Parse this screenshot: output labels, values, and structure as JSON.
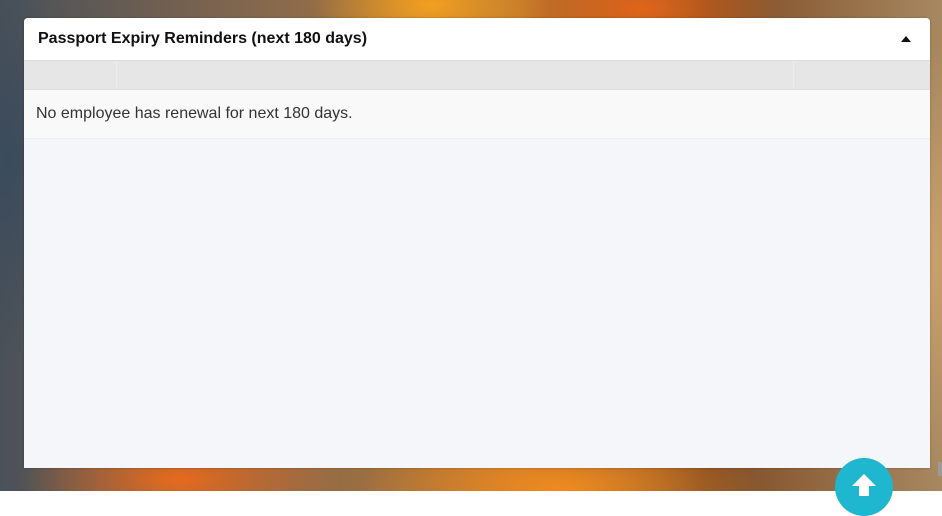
{
  "panel": {
    "title": "Passport Expiry Reminders (next 180 days)",
    "collapse_icon": "caret-up-icon",
    "table": {
      "columns": [
        "",
        "",
        ""
      ],
      "empty_message": "No employee has renewal for next 180 days."
    }
  },
  "scroll_top_button": {
    "icon": "arrow-up-icon",
    "color": "#1fb6cf"
  }
}
